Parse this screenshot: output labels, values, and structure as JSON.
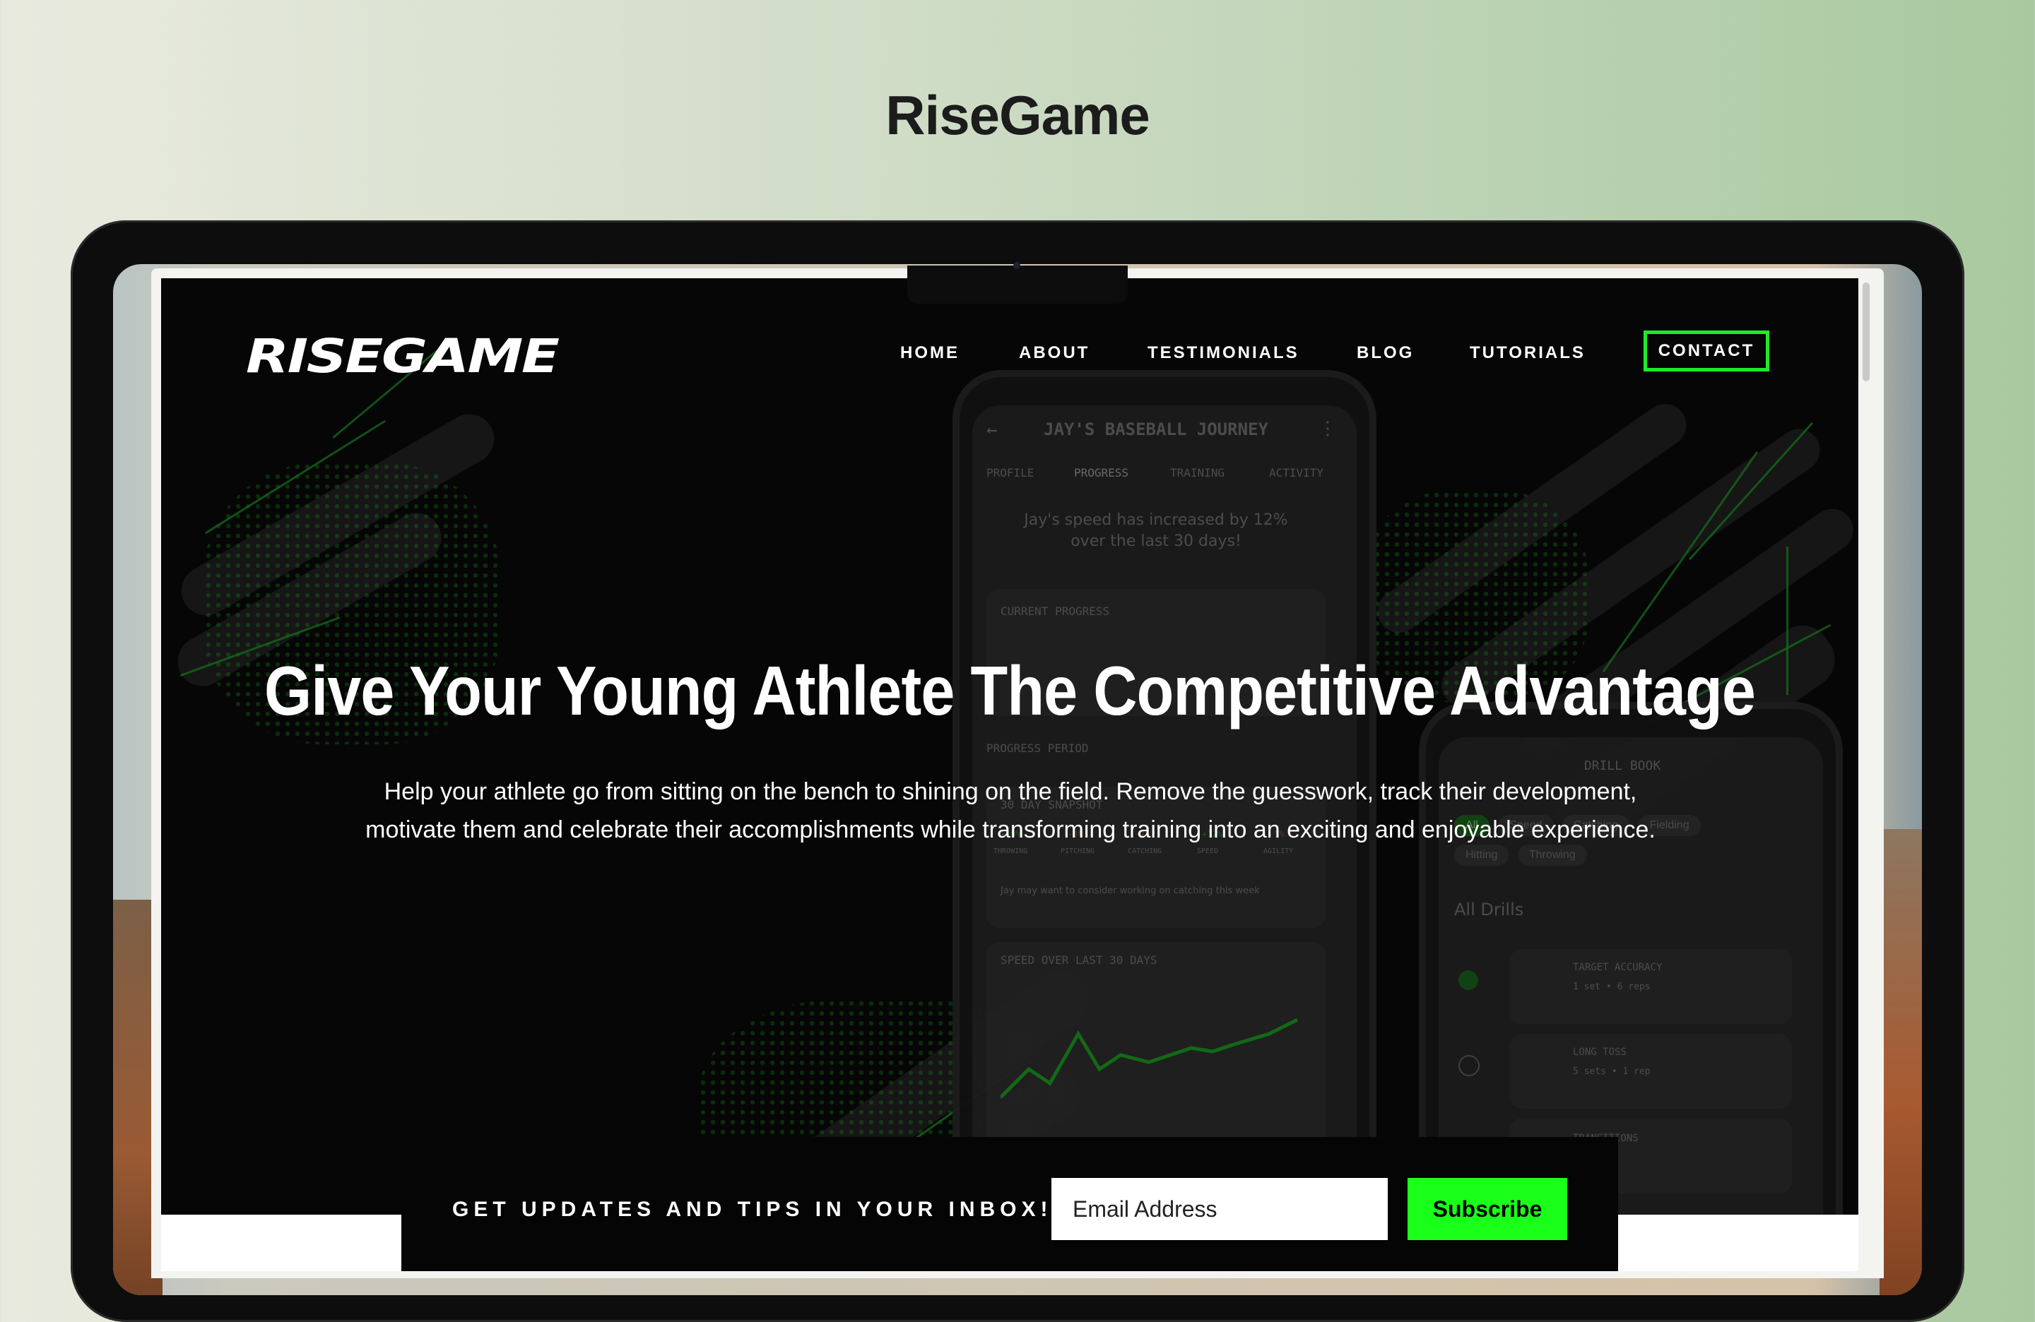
{
  "page": {
    "heading": "RiseGame"
  },
  "site": {
    "logo": "RISEGAME",
    "nav": [
      {
        "label": "HOME"
      },
      {
        "label": "ABOUT"
      },
      {
        "label": "TESTIMONIALS"
      },
      {
        "label": "BLOG"
      },
      {
        "label": "TUTORIALS"
      }
    ],
    "contact_label": "CONTACT",
    "accent_color": "#1eea2a",
    "hero": {
      "title": "Give Your Young Athlete The Competitive Advantage",
      "subtitle_line1": "Help your athlete go from sitting on the bench to shining on the field. Remove the guesswork, track their development,",
      "subtitle_line2": "motivate them and celebrate their accomplishments while transforming training into an exciting and enjoyable experience."
    },
    "phone_left": {
      "title": "JAY'S BASEBALL JOURNEY",
      "tabs": [
        "PROFILE",
        "PROGRESS",
        "TRAINING",
        "ACTIVITY"
      ],
      "message_line1": "Jay's speed has increased by 12%",
      "message_line2": "over the last 30 days!",
      "current_progress": "CURRENT PROGRESS",
      "progress_period": "PROGRESS PERIOD",
      "snapshot": "30 DAY SNAPSHOT",
      "stats": [
        {
          "value": "+19%",
          "label": "THROWING"
        },
        {
          "value": "-3%",
          "label": "PITCHING"
        },
        {
          "value": "-7%",
          "label": "CATCHING"
        },
        {
          "value": "+12%",
          "label": "SPEED"
        },
        {
          "value": "-5%",
          "label": "AGILITY"
        }
      ],
      "note": "Jay may want to consider working on catching this week",
      "speed_title": "SPEED OVER LAST 30 DAYS"
    },
    "phone_right": {
      "header": "DRILL BOOK",
      "chips": [
        "All",
        "Speed",
        "Catching",
        "Fielding",
        "Hitting",
        "Throwing"
      ],
      "section": "All Drills",
      "drills": [
        {
          "title": "TARGET ACCURACY",
          "detail": "1 set • 6 reps"
        },
        {
          "title": "LONG TOSS",
          "detail": "5 sets • 1 rep"
        },
        {
          "title": "TRANSITIONS",
          "detail": ""
        }
      ]
    },
    "signup": {
      "label": "GET UPDATES AND TIPS IN YOUR INBOX!",
      "email_placeholder": "Email Address",
      "button": "Subscribe"
    }
  }
}
